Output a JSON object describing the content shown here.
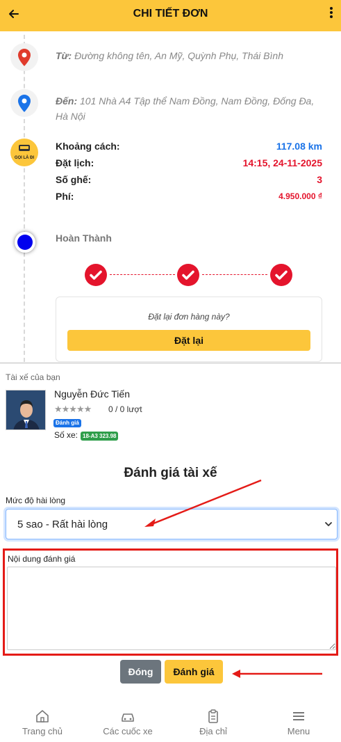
{
  "header": {
    "title": "CHI TIẾT ĐƠN",
    "back_icon": "arrow-left-icon",
    "menu_icon": "more-vertical-icon"
  },
  "route": {
    "from_label": "Từ:",
    "from_value": "Đường không tên, An Mỹ, Quỳnh Phụ, Thái Bình",
    "to_label": "Đến:",
    "to_value": "101 Nhà A4 Tập thể Nam Đồng, Nam Đồng, Đống Đa, Hà Nội"
  },
  "logo_text": "GỌI LÀ ĐI",
  "trip": {
    "distance_label": "Khoảng cách:",
    "distance_value": "117.08 km",
    "schedule_label": "Đặt lịch:",
    "schedule_value": "14:15, 24-11-2025",
    "seats_label": "Số ghế:",
    "seats_value": "3",
    "fee_label": "Phí:",
    "fee_value": "4.950.000 ₫"
  },
  "status": {
    "text": "Hoàn Thành",
    "steps_completed": 3
  },
  "reorder": {
    "question": "Đặt lại đơn hàng này?",
    "button": "Đặt lại"
  },
  "driver": {
    "caption": "Tài xế của bạn",
    "name": "Nguyễn Đức Tiến",
    "stars": "★★★★★",
    "rating_count": "0 / 0 lượt",
    "rate_badge": "Đánh giá",
    "plate_label": "Số xe:",
    "plate": "18-A3 323.98"
  },
  "rating_form": {
    "title": "Đánh giá tài xế",
    "level_label": "Mức độ hài lòng",
    "level_value": "5 sao - Rất hài lòng",
    "content_label": "Nội dung đánh giá",
    "content_value": "",
    "close_button": "Đóng",
    "submit_button": "Đánh giá"
  },
  "nav": [
    {
      "label": "Trang chủ",
      "icon": "home-icon"
    },
    {
      "label": "Các cuốc xe",
      "icon": "car-icon"
    },
    {
      "label": "Địa chỉ",
      "icon": "clipboard-icon"
    },
    {
      "label": "Menu",
      "icon": "hamburger-icon"
    }
  ],
  "colors": {
    "brand": "#fcc63b",
    "accent_red": "#e4142c",
    "distance_blue": "#1a73e8",
    "annotation": "#e41b17"
  }
}
